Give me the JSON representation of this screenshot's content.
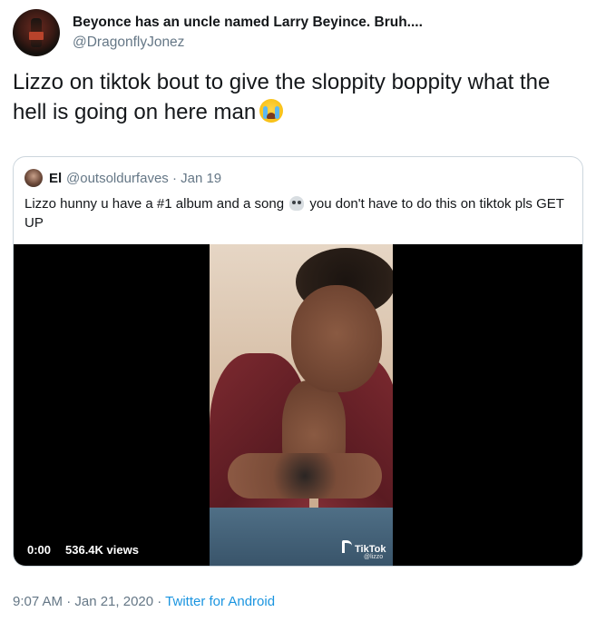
{
  "tweet": {
    "display_name": "Beyonce has an uncle named Larry Beyince. Bruh....",
    "handle": "@DragonflyJonez",
    "text": "Lizzo on tiktok bout to give the sloppity boppity what the hell is going on here man",
    "emoji": "loudly-crying-face-emoji"
  },
  "quoted_tweet": {
    "display_name": "El",
    "handle_and_date": "@outsoldurfaves · Jan 19",
    "text_before_emoji": "Lizzo hunny u have a #1 album and a song",
    "emoji": "skull-emoji",
    "text_after_emoji": " you don't have to do this on tiktok pls GET UP"
  },
  "media": {
    "timestamp": "0:00",
    "views": "536.4K views",
    "watermark": "TikTok",
    "watermark_user": "@lizzo"
  },
  "footer": {
    "time_date": "9:07 AM · Jan 21, 2020 · ",
    "source": "Twitter for Android"
  },
  "colors": {
    "text": "#14171a",
    "secondary": "#657786",
    "link": "#1b95e0",
    "border": "#ccd6dd"
  }
}
